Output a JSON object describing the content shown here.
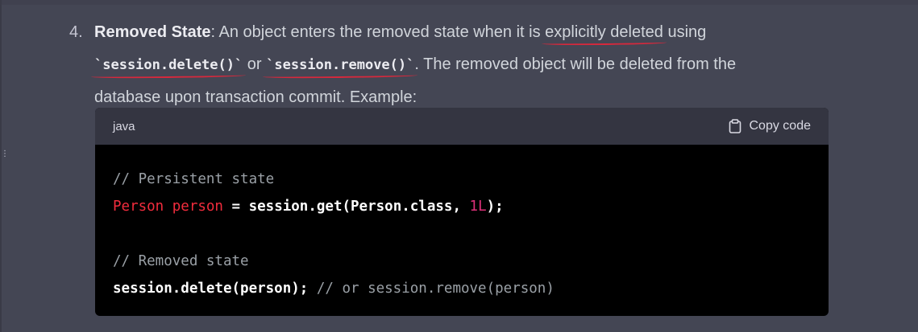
{
  "list_item": {
    "number": "4.",
    "title": "Removed State",
    "text_1": ": An object enters the removed state when it is ",
    "underlined_1": "explicitly deleted",
    "text_2": " using",
    "code_1": "`session.delete()`",
    "text_3": " or ",
    "code_2": "`session.remove()`",
    "text_4": ". The removed object will be deleted from the",
    "text_5": "database upon transaction commit. Example:"
  },
  "code_block": {
    "language": "java",
    "copy_label": "Copy code",
    "lines": {
      "comment_1": "// Persistent state",
      "l2_type": "Person",
      "l2_var": " person",
      "l2_rest": " = session.get(Person.class, ",
      "l2_num": "1L",
      "l2_end": ");",
      "comment_2": "// Removed state",
      "l5_code": "session.delete(person);",
      "l5_comment": " // or session.remove(person)"
    }
  },
  "side_mark": "⋮",
  "colors": {
    "background": "#444654",
    "code_bg": "#000000",
    "code_header_bg": "#343541",
    "annotation_red": "#d8283c",
    "keyword_red": "#f22c3d",
    "number_pink": "#df3079",
    "comment_gray": "#9aa0a6"
  }
}
